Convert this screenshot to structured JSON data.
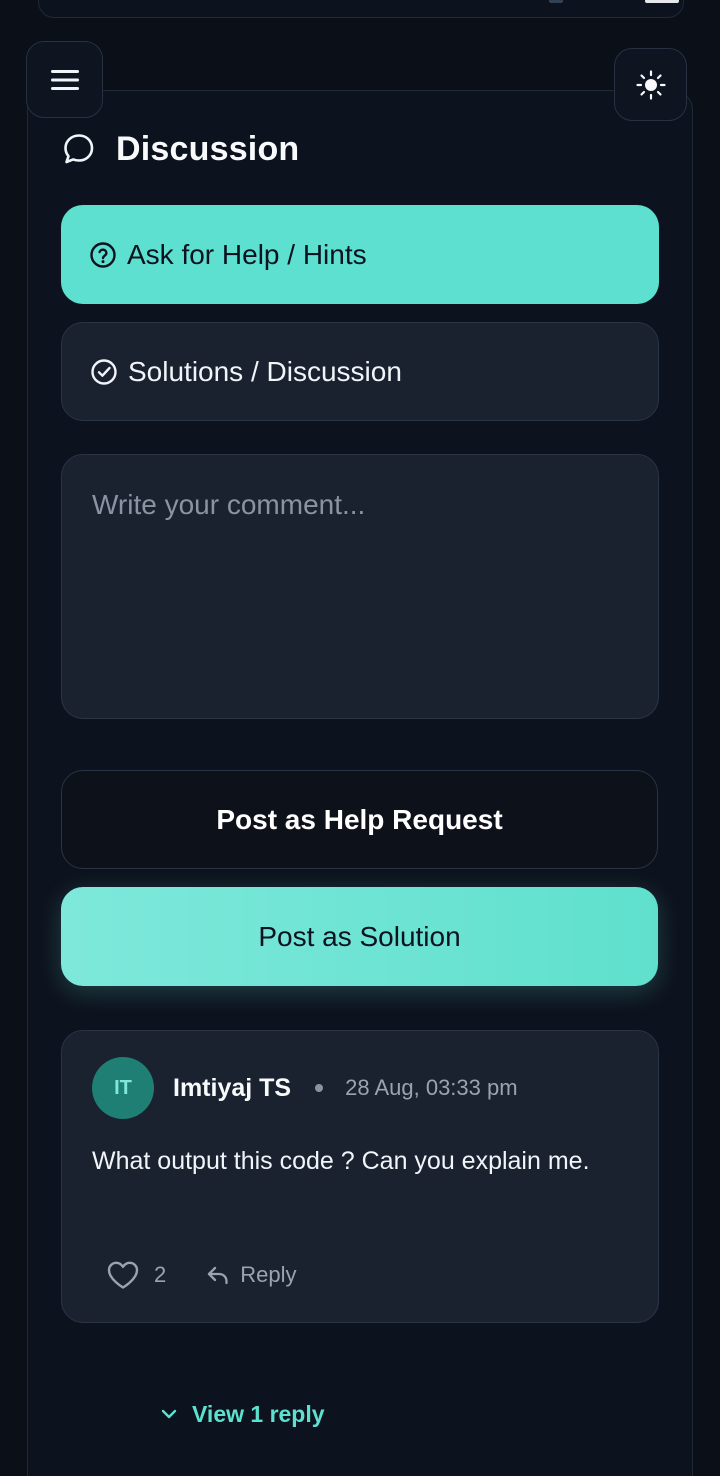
{
  "header": {
    "menu_icon": "hamburger-menu-icon",
    "theme_icon": "sun-icon"
  },
  "discussion": {
    "title": "Discussion",
    "title_icon": "chat-bubble-icon"
  },
  "tabs": [
    {
      "label": "Ask for Help / Hints",
      "icon": "question-circle-icon",
      "active": true
    },
    {
      "label": "Solutions / Discussion",
      "icon": "check-circle-icon",
      "active": false
    }
  ],
  "composer": {
    "placeholder": "Write your comment...",
    "value": ""
  },
  "actions": {
    "help_label": "Post as Help Request",
    "solution_label": "Post as Solution"
  },
  "comments": [
    {
      "initials": "IT",
      "author": "Imtiyaj TS",
      "time": "28 Aug, 03:33 pm",
      "text": "What output this code ? Can you explain me.",
      "likes": "2",
      "reply_label": "Reply"
    }
  ],
  "view_replies": "View 1 reply",
  "colors": {
    "accent": "#5ee0d0",
    "background": "#0a0f18",
    "surface": "#1a2230",
    "avatar": "#1f7f74"
  }
}
